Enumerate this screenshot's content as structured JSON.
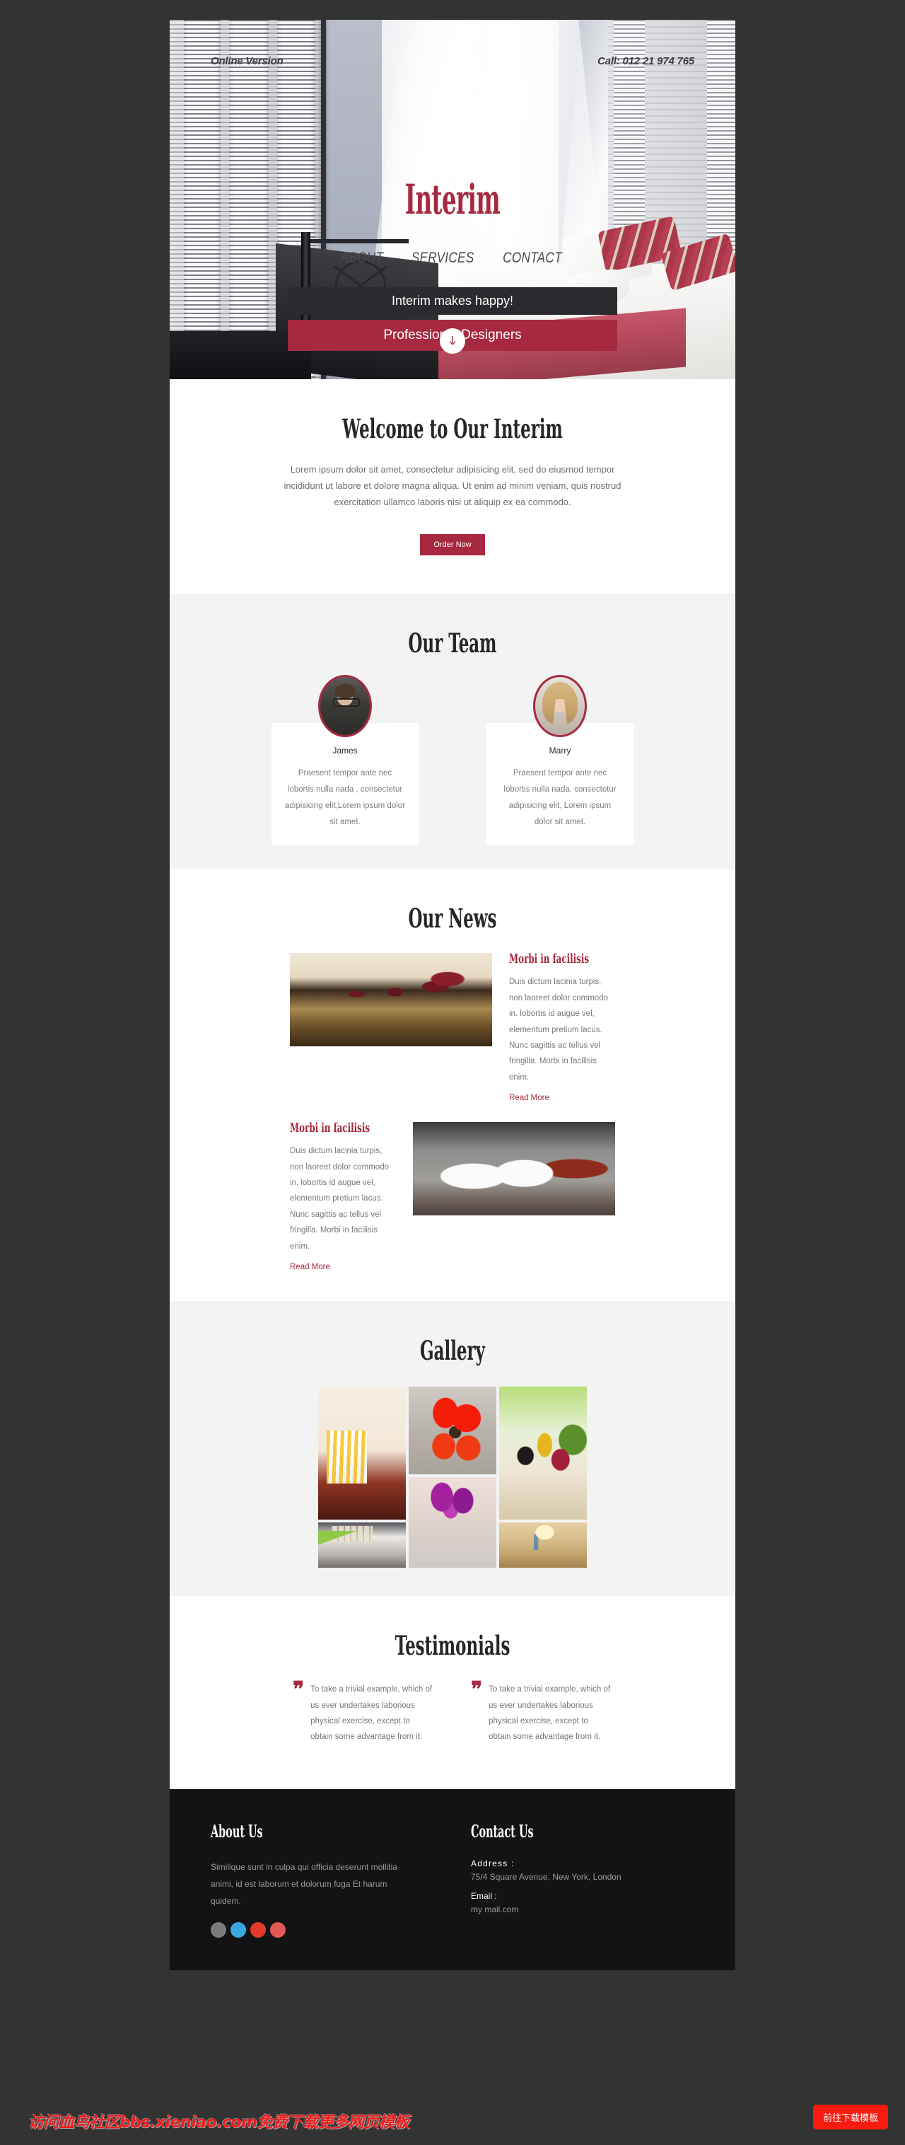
{
  "hero": {
    "online_version": "Online Version",
    "phone": "Call: 012 21 974 765",
    "brand": "Interim",
    "nav": [
      {
        "label": "ABOUT"
      },
      {
        "label": "SERVICES"
      },
      {
        "label": "CONTACT"
      }
    ],
    "slogan_dark": "Interim makes happy!",
    "slogan_red": "Professional Designers",
    "scroll_icon": "arrow-down-icon"
  },
  "welcome": {
    "title": "Welcome to Our Interim",
    "body": "Lorem ipsum dolor sit amet, consectetur adipisicing elit, sed do eiusmod tempor incididunt ut labore et dolore magna aliqua. Ut enim ad minim veniam, quis nostrud exercitation ullamco laboris nisi ut aliquip ex ea commodo.",
    "cta": "Order Now"
  },
  "team": {
    "title": "Our Team",
    "members": [
      {
        "name": "James",
        "text": "Praesent tempor ante nec lobortis nulla nada , consectetur adipisicing elit,Lorem ipsum dolor sit amet.",
        "avatar": "avatar-james"
      },
      {
        "name": "Marry",
        "text": "Praesent tempor ante nec lobortis nulla nada, consectetur adipisicing elit, Lorem ipsum dolor sit amet.",
        "avatar": "avatar-marry"
      }
    ]
  },
  "news": {
    "title": "Our News",
    "items": [
      {
        "heading": "Morbi in facilisis",
        "body": "Duis dictum lacinia turpis, non laoreet dolor commodo in. lobortis id augue vel, elementum pretium lacus. Nunc sagittis ac tellus vel fringilla. Morbi in facilisis enim.",
        "link": "Read More",
        "image": "banquet-hall-photo"
      },
      {
        "heading": "Morbi in facilisis",
        "body": "Duis dictum lacinia turpis, non laoreet dolor commodo in. lobortis id augue vel, elementum pretium lacus. Nunc sagittis ac tellus vel fringilla. Morbi in facilisis enim.",
        "link": "Read More",
        "image": "elephant-figurines-photo"
      }
    ]
  },
  "gallery": {
    "title": "Gallery",
    "images": [
      {
        "name": "yellow-striped-chair-photo"
      },
      {
        "name": "red-amaryllis-flowers-photo"
      },
      {
        "name": "kitchen-still-life-photo"
      },
      {
        "name": "green-blanket-bedroom-photo"
      },
      {
        "name": "purple-flowers-jar-photo"
      },
      {
        "name": "ballroom-chandelier-photo"
      }
    ]
  },
  "testimonials": {
    "title": "Testimonials",
    "items": [
      {
        "quote_icon": "quote-mark-icon",
        "text": "To take a trivial example, which of us ever undertakes laborious physical exercise, except to obtain some advantage from it."
      },
      {
        "quote_icon": "quote-mark-icon",
        "text": "To take a trivial example, which of us ever undertakes laborious physical exercise, except to obtain some advantage from it."
      }
    ]
  },
  "footer": {
    "about_title": "About Us",
    "about_text": "Similique sunt in culpa qui officia deserunt mollitia animi, id est laborum et dolorum fuga Et harum quidem.",
    "contact_title": "Contact Us",
    "address_label": "Address :",
    "address_value": "75/4 Square Avenue, New York, London",
    "email_label": "Email :",
    "email_value": "my mail.com",
    "socials": [
      {
        "name": "facebook-icon"
      },
      {
        "name": "twitter-icon"
      },
      {
        "name": "google-plus-icon"
      },
      {
        "name": "rss-icon"
      }
    ]
  },
  "overlay": {
    "watermark": "访问血鸟社区bbs.xieniao.com免费下载更多网页模板",
    "download_button": "前往下载模板"
  },
  "colors": {
    "accent": "#a6293f",
    "dark": "#2b2a2e",
    "footer_bg": "#131214",
    "page_bg": "#333333",
    "grey_section": "#f3f3f3",
    "download_red": "#f81c10"
  }
}
